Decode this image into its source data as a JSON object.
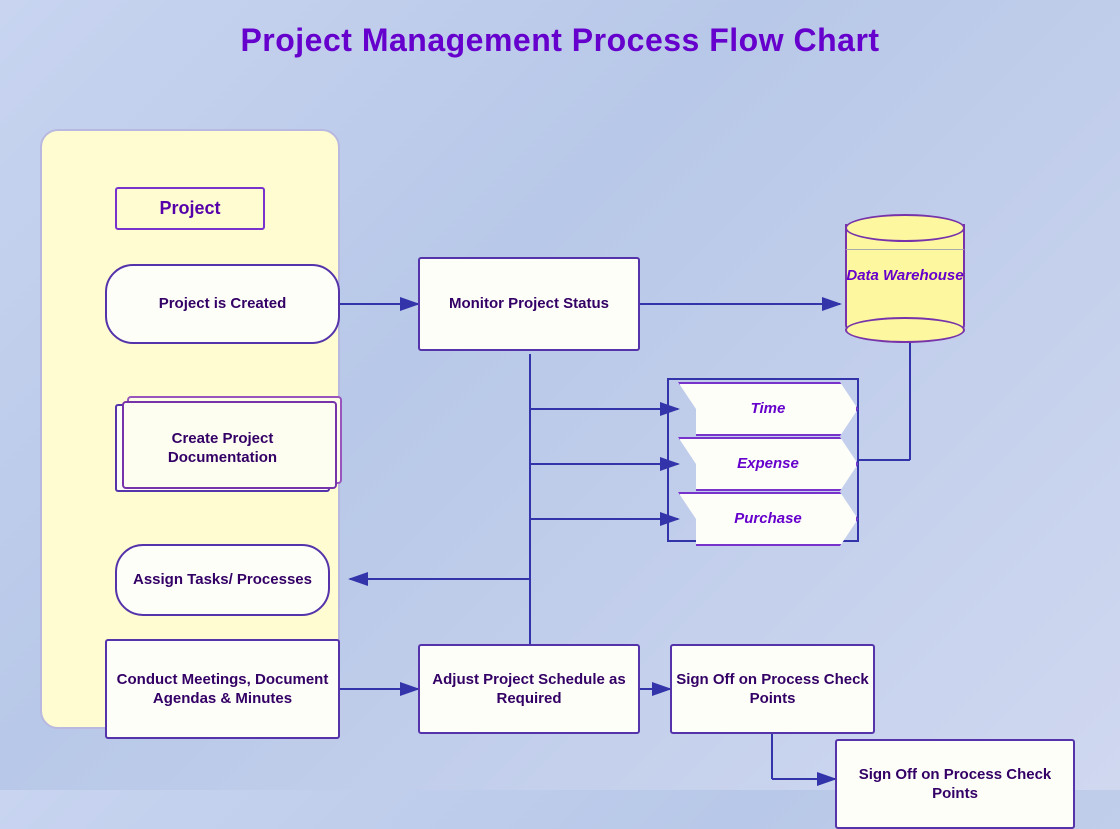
{
  "title": "Project Management Process Flow Chart",
  "nodes": {
    "swimlane_title": "Project",
    "project_created": "Project is Created",
    "create_docs": "Create Project Documentation",
    "assign_tasks": "Assign Tasks/ Processes",
    "conduct_meetings": "Conduct Meetings, Document Agendas & Minutes",
    "monitor_status": "Monitor Project Status",
    "data_warehouse": "Data Warehouse",
    "time": "Time",
    "expense": "Expense",
    "purchase": "Purchase",
    "adjust_schedule": "Adjust Project Schedule as Required",
    "sign_off_1": "Sign Off on Process Check Points",
    "sign_off_2": "Sign Off on Process Check Points"
  },
  "colors": {
    "title": "#6600cc",
    "border": "#5533aa",
    "text": "#330066",
    "purple_text": "#6600cc",
    "bg_swimlane": "#fefcd0",
    "bg_node": "#fefef8",
    "bg_cylinder": "#fdf8a0",
    "arrow": "#3333aa"
  }
}
